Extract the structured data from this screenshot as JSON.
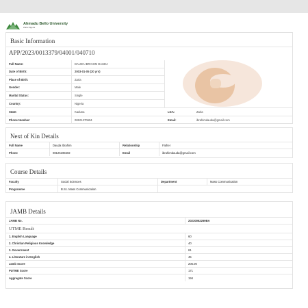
{
  "header": {
    "university_name": "Ahmadu Bello University",
    "university_sub": "Zaria Nigeria"
  },
  "basic": {
    "title": "Basic Information",
    "application_no": "APP/2023/0013379/04001/040710",
    "rows": [
      {
        "label": "Full Name:",
        "value": "DAUDA   IBRAHIM DAUDA"
      },
      {
        "label": "Date of Birth:",
        "value": "2003-01-05   (20 yrs)"
      },
      {
        "label": "Place of Birth:",
        "value": "Zaria"
      },
      {
        "label": "Gender:",
        "value": "Male"
      },
      {
        "label": "Marital Status:",
        "value": "Single"
      },
      {
        "label": "Country:",
        "value": "Nigeria"
      }
    ],
    "state_label": "State:",
    "state_value": "Kaduna",
    "lga_label": "LGA:",
    "lga_value": "Zaria",
    "phone_label": "Phone Number:",
    "phone_value": "08101270604",
    "email_label": "Email:",
    "email_value": "ibrahimdauda@gmail.com"
  },
  "kin": {
    "title": "Next of Kin Details",
    "fullname_label": "Full Name",
    "fullname_value": "Dauda Ibrahim",
    "relationship_label": "Relationship",
    "relationship_value": "Father",
    "phone_label": "Phone",
    "phone_value": "08125195502",
    "email_label": "Email",
    "email_value": "ibrahimdauda@gmail.com"
  },
  "course": {
    "title": "Course Details",
    "faculty_label": "Faculty",
    "faculty_value": "Social Sciences",
    "department_label": "Department",
    "department_value": "Mass Communication",
    "programme_label": "Programme",
    "programme_value": "B.Sc. Mass Communication"
  },
  "jamb": {
    "title": "JAMB Details",
    "jamb_no_label": "JAMB No.",
    "jamb_no_value": "20230062269BA",
    "utme_title": "UTME Result",
    "subjects": [
      {
        "label": "1.  English Language",
        "value": "60"
      },
      {
        "label": "2.  Christian Religious Knowledge",
        "value": "40"
      },
      {
        "label": "3.  Government",
        "value": "61"
      },
      {
        "label": "4.  Literature in English",
        "value": "45"
      }
    ],
    "totals": [
      {
        "label": "Jamb Score",
        "value": "206.00"
      },
      {
        "label": "PUTME Score",
        "value": "171"
      },
      {
        "label": "Aggregate Score",
        "value": "194"
      }
    ]
  }
}
